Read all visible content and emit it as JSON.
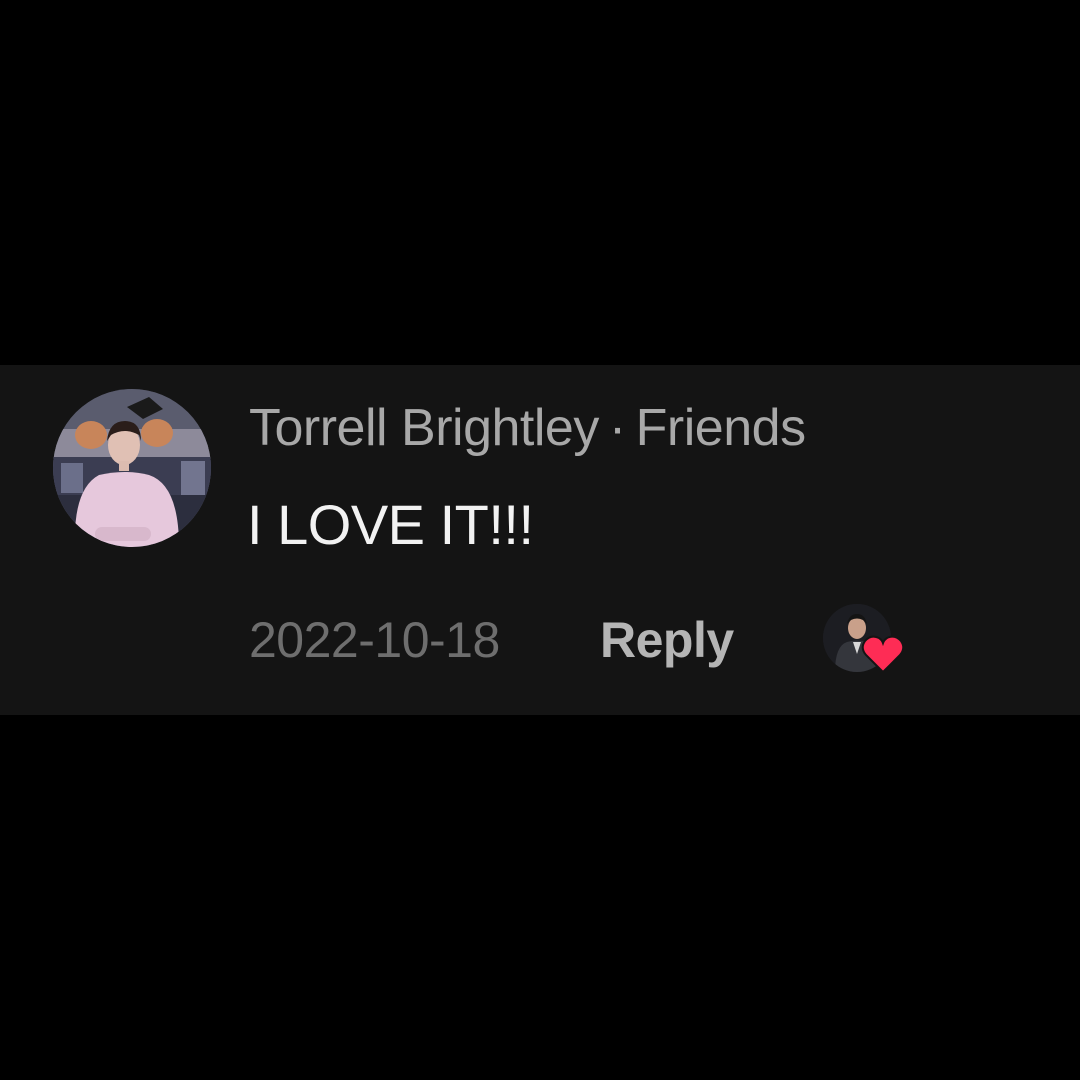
{
  "comment": {
    "author": "Torrell Brightley",
    "separator": "·",
    "relationship": "Friends",
    "text": "I LOVE IT!!!",
    "date": "2022-10-18",
    "reply_label": "Reply",
    "liked_by_icon": "heart-icon"
  },
  "colors": {
    "page_background": "#000000",
    "card_background": "#141414",
    "author_text": "#a8a8a8",
    "comment_text": "#f2f2f2",
    "date_text": "#6e6e6e",
    "reply_text": "#b5b5b5",
    "heart": "#fe2c55"
  }
}
